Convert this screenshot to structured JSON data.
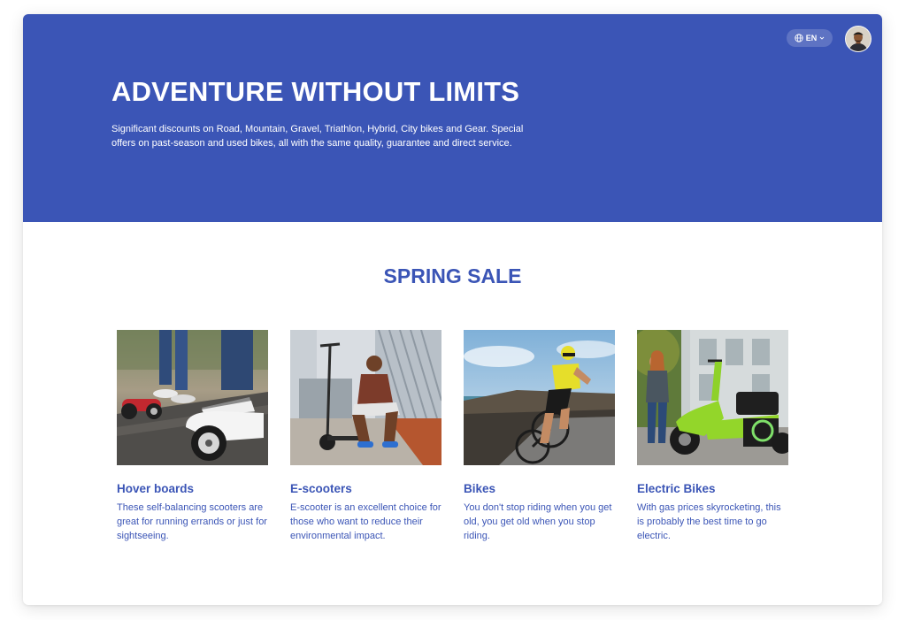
{
  "header": {
    "language_label": "EN",
    "icons": [
      "globe-icon",
      "chevron-down-icon"
    ]
  },
  "hero": {
    "title": "ADVENTURE WITHOUT LIMITS",
    "subtitle": "Significant discounts on Road, Mountain, Gravel, Triathlon, Hybrid, City bikes and Gear. Special offers on past-season and used bikes, all with the same quality, guarantee and direct service.",
    "background_color": "#3b55b6"
  },
  "sale": {
    "title": "SPRING SALE",
    "cards": [
      {
        "title": "Hover boards",
        "text": "These self-balancing scooters are great for running errands or just for sightseeing."
      },
      {
        "title": "E-scooters",
        "text": "E-scooter is an excellent choice for those who want to reduce their environmental impact."
      },
      {
        "title": "Bikes",
        "text": "You don't stop riding when you get old, you get old when you stop riding."
      },
      {
        "title": "Electric Bikes",
        "text": "With gas prices skyrocketing, this is probably the best time to go electric."
      }
    ]
  },
  "colors": {
    "accent": "#3b55b6",
    "text_on_accent": "#ffffff"
  }
}
